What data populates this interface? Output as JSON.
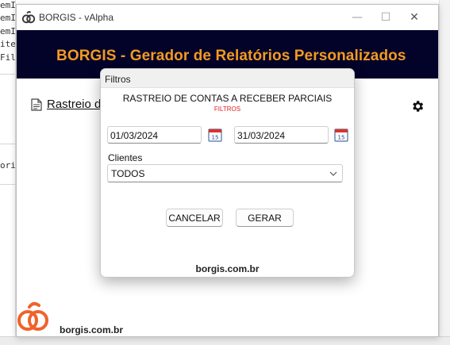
{
  "background_editor": {
    "lines": [
      "emInfo:",
      "emI",
      "emI",
      "ite",
      "Fil",
      "",
      "ori"
    ]
  },
  "main_window": {
    "title": "BORGIS - vAlpha",
    "minimize_glyph": "—",
    "maximize_glyph": "☐",
    "close_glyph": "✕",
    "header_title": "BORGIS - Gerador de Relatórios Personalizados",
    "report_link": "Rastreio d",
    "footer_brand": "borgis.com.br",
    "colors": {
      "header_bg": "#03032a",
      "header_text": "#f39a1f",
      "logo": "#f0622a"
    }
  },
  "dialog": {
    "title": "Filtros",
    "heading": "RASTREIO DE CONTAS A RECEBER PARCIAIS",
    "subheading": "FILTROS",
    "start_date": "01/03/2024",
    "end_date": "31/03/2024",
    "calendar_day": "15",
    "clientes_label": "Clientes",
    "clientes_value": "TODOS",
    "cancel_label": "CANCELAR",
    "generate_label": "GERAR",
    "footer": "borgis.com.br"
  }
}
